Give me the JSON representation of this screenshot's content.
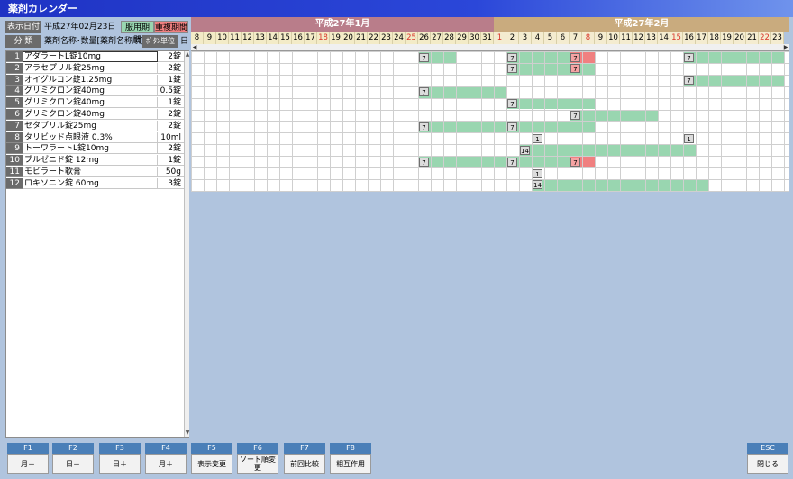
{
  "window": {
    "title": "薬剤カレンダー"
  },
  "header": {
    "display_date_label": "表示日付",
    "display_date_value": "平成27年02月23日",
    "legend_dosing": "服用期間",
    "legend_overlap": "重複期間",
    "category_label": "分 類",
    "category_value": "薬剤名称･数量[薬剤名称順]",
    "unit_label": "ﾎﾞﾀﾝ単位",
    "unit_value": "日"
  },
  "calendar": {
    "months": [
      {
        "label": "平成27年1月",
        "color": "#b97d8a"
      },
      {
        "label": "平成27年2月",
        "color": "#c9ab7e"
      }
    ],
    "days": [
      {
        "d": "8",
        "w": false
      },
      {
        "d": "9",
        "w": false
      },
      {
        "d": "10",
        "w": false
      },
      {
        "d": "11",
        "w": false
      },
      {
        "d": "12",
        "w": false
      },
      {
        "d": "13",
        "w": false
      },
      {
        "d": "14",
        "w": false
      },
      {
        "d": "15",
        "w": false
      },
      {
        "d": "16",
        "w": false
      },
      {
        "d": "17",
        "w": false
      },
      {
        "d": "18",
        "w": true
      },
      {
        "d": "19",
        "w": false
      },
      {
        "d": "20",
        "w": false
      },
      {
        "d": "21",
        "w": false
      },
      {
        "d": "22",
        "w": false
      },
      {
        "d": "23",
        "w": false
      },
      {
        "d": "24",
        "w": false
      },
      {
        "d": "25",
        "w": true
      },
      {
        "d": "26",
        "w": false
      },
      {
        "d": "27",
        "w": false
      },
      {
        "d": "28",
        "w": false
      },
      {
        "d": "29",
        "w": false
      },
      {
        "d": "30",
        "w": false
      },
      {
        "d": "31",
        "w": false
      },
      {
        "d": "1",
        "w": true
      },
      {
        "d": "2",
        "w": false
      },
      {
        "d": "3",
        "w": false
      },
      {
        "d": "4",
        "w": false
      },
      {
        "d": "5",
        "w": false
      },
      {
        "d": "6",
        "w": false
      },
      {
        "d": "7",
        "w": false
      },
      {
        "d": "8",
        "w": true
      },
      {
        "d": "9",
        "w": false
      },
      {
        "d": "10",
        "w": false
      },
      {
        "d": "11",
        "w": false
      },
      {
        "d": "12",
        "w": false
      },
      {
        "d": "13",
        "w": false
      },
      {
        "d": "14",
        "w": false
      },
      {
        "d": "15",
        "w": true
      },
      {
        "d": "16",
        "w": false
      },
      {
        "d": "17",
        "w": false
      },
      {
        "d": "18",
        "w": false
      },
      {
        "d": "19",
        "w": false
      },
      {
        "d": "20",
        "w": false
      },
      {
        "d": "21",
        "w": false
      },
      {
        "d": "22",
        "w": true
      },
      {
        "d": "23",
        "w": false
      }
    ],
    "colors": {
      "jan_bg": "#f3ebc7",
      "feb_bg": "#f4ecd0",
      "weekend": "#d9352a",
      "bar": "#99d6b0",
      "overlap": "#f08080"
    }
  },
  "drugs": [
    {
      "no": "1",
      "name": "アダラートL錠10mg",
      "amount": "2錠"
    },
    {
      "no": "2",
      "name": "アラセプリル錠25mg",
      "amount": "2錠"
    },
    {
      "no": "3",
      "name": "オイグルコン錠1.25mg",
      "amount": "1錠"
    },
    {
      "no": "4",
      "name": "グリミクロン錠40mg",
      "amount": "0.5錠"
    },
    {
      "no": "5",
      "name": "グリミクロン錠40mg",
      "amount": "1錠"
    },
    {
      "no": "6",
      "name": "グリミクロン錠40mg",
      "amount": "2錠"
    },
    {
      "no": "7",
      "name": "セタプリル錠25mg",
      "amount": "2錠"
    },
    {
      "no": "8",
      "name": "タリビッド点眼液 0.3%",
      "amount": "10ml"
    },
    {
      "no": "9",
      "name": "トーワラートL錠10mg",
      "amount": "2錠"
    },
    {
      "no": "10",
      "name": "ブルゼニド錠 12mg",
      "amount": "1錠"
    },
    {
      "no": "11",
      "name": "モビラート軟膏",
      "amount": "50g"
    },
    {
      "no": "12",
      "name": "ロキソニン錠 60mg",
      "amount": "3錠"
    }
  ],
  "schedule": [
    {
      "row": 0,
      "bars": [
        [
          18,
          20
        ],
        [
          25,
          30
        ],
        [
          31,
          31
        ],
        [
          39,
          46
        ]
      ],
      "marks": [
        [
          18,
          "7",
          false
        ],
        [
          25,
          "7",
          false
        ],
        [
          30,
          "7",
          true
        ],
        [
          39,
          "7",
          false
        ]
      ],
      "red": [
        [
          30,
          31
        ]
      ]
    },
    {
      "row": 1,
      "bars": [
        [
          25,
          31
        ]
      ],
      "marks": [
        [
          25,
          "7",
          false
        ],
        [
          30,
          "7",
          true
        ]
      ],
      "red": []
    },
    {
      "row": 2,
      "bars": [
        [
          39,
          46
        ]
      ],
      "marks": [
        [
          39,
          "7",
          false
        ]
      ],
      "red": []
    },
    {
      "row": 3,
      "bars": [
        [
          18,
          24
        ]
      ],
      "marks": [
        [
          18,
          "7",
          false
        ]
      ],
      "red": []
    },
    {
      "row": 4,
      "bars": [
        [
          25,
          31
        ]
      ],
      "marks": [
        [
          25,
          "7",
          false
        ]
      ],
      "red": []
    },
    {
      "row": 5,
      "bars": [
        [
          30,
          36
        ]
      ],
      "marks": [
        [
          30,
          "7",
          false
        ]
      ],
      "red": []
    },
    {
      "row": 6,
      "bars": [
        [
          18,
          31
        ]
      ],
      "marks": [
        [
          18,
          "7",
          false
        ],
        [
          25,
          "7",
          false
        ]
      ],
      "red": []
    },
    {
      "row": 7,
      "bars": [],
      "marks": [
        [
          27,
          "1",
          false
        ],
        [
          39,
          "1",
          false
        ]
      ],
      "red": []
    },
    {
      "row": 8,
      "bars": [
        [
          26,
          39
        ]
      ],
      "marks": [
        [
          26,
          "14",
          false
        ]
      ],
      "red": []
    },
    {
      "row": 9,
      "bars": [
        [
          18,
          31
        ]
      ],
      "marks": [
        [
          18,
          "7",
          false
        ],
        [
          25,
          "7",
          false
        ],
        [
          30,
          "7",
          true
        ]
      ],
      "red": [
        [
          30,
          31
        ]
      ]
    },
    {
      "row": 10,
      "bars": [],
      "marks": [
        [
          27,
          "1",
          false
        ]
      ],
      "red": []
    },
    {
      "row": 11,
      "bars": [
        [
          27,
          40
        ]
      ],
      "marks": [
        [
          27,
          "14",
          false
        ]
      ],
      "red": []
    }
  ],
  "fkeys": [
    {
      "key": "F1",
      "label": "月－"
    },
    {
      "key": "F2",
      "label": "日－"
    },
    {
      "key": "F3",
      "label": "日＋"
    },
    {
      "key": "F4",
      "label": "月＋"
    },
    {
      "key": "F5",
      "label": "表示変更"
    },
    {
      "key": "F6",
      "label": "ソート順変更"
    },
    {
      "key": "F7",
      "label": "前回比較"
    },
    {
      "key": "F8",
      "label": "相互作用"
    },
    {
      "key": "ESC",
      "label": "閉じる"
    }
  ]
}
